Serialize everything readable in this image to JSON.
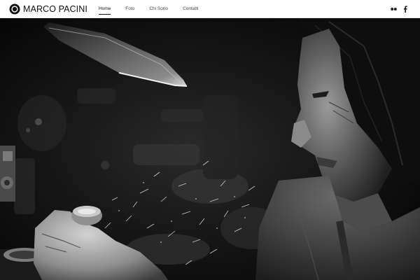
{
  "site": {
    "brand": "MARCO PACINI"
  },
  "nav": {
    "items": [
      {
        "label": "Home",
        "active": true
      },
      {
        "label": "Foto",
        "active": false
      },
      {
        "label": "Chi Sono",
        "active": false
      },
      {
        "label": "Contatti",
        "active": false
      }
    ]
  },
  "social": [
    "flickr-icon",
    "facebook-icon"
  ],
  "hero": {
    "description": "Black and white photograph of a craftsman polishing a small object under a lamp, dust particles flying"
  }
}
